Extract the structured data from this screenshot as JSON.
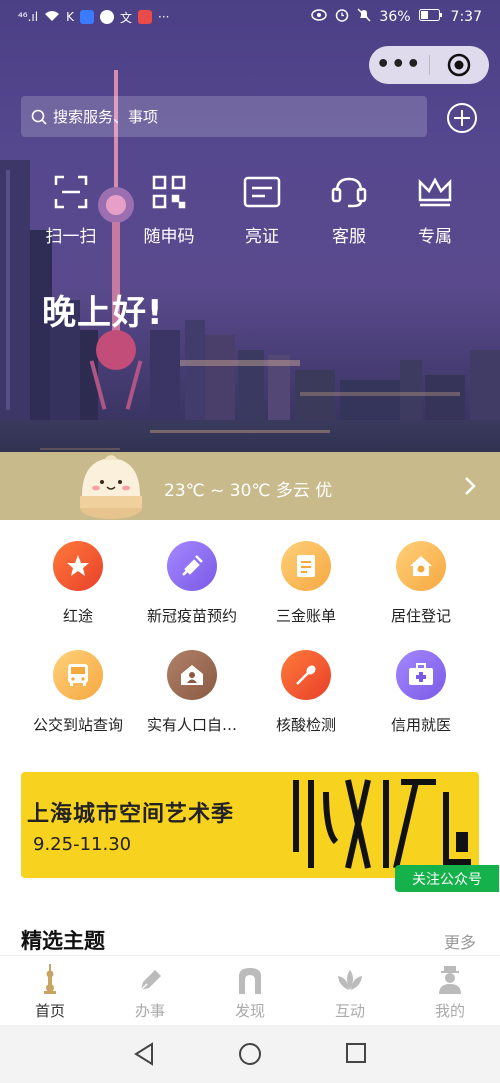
{
  "status": {
    "left": "⁴⁶.ıl",
    "battery": "36%",
    "time": "7:37"
  },
  "capsule": {
    "menu_icon": "more-dots-icon",
    "close_icon": "target-icon"
  },
  "search": {
    "placeholder": "搜索服务、事项"
  },
  "quick_actions": [
    {
      "label": "扫一扫",
      "icon": "scan-icon"
    },
    {
      "label": "随申码",
      "icon": "qr-code-icon"
    },
    {
      "label": "亮证",
      "icon": "id-card-icon"
    },
    {
      "label": "客服",
      "icon": "headset-icon"
    },
    {
      "label": "专属",
      "icon": "crown-icon"
    }
  ],
  "greeting": "晚上好!",
  "weather": {
    "text": "23℃ ~ 30℃ 多云 优"
  },
  "services": [
    {
      "label": "红途",
      "icon": "star-icon",
      "color": "#f0542a"
    },
    {
      "label": "新冠疫苗预约",
      "icon": "syringe-icon",
      "color": "#8a6cf0"
    },
    {
      "label": "三金账单",
      "icon": "bill-icon",
      "color": "#f7b04a"
    },
    {
      "label": "居住登记",
      "icon": "home-icon",
      "color": "#f7b04a"
    },
    {
      "label": "公交到站查询",
      "icon": "bus-icon",
      "color": "#f7b04a"
    },
    {
      "label": "实有人口自…",
      "icon": "person-house-icon",
      "color": "#9b6b52"
    },
    {
      "label": "核酸检测",
      "icon": "swab-icon",
      "color": "#f0542a"
    },
    {
      "label": "信用就医",
      "icon": "medical-kit-icon",
      "color": "#8a6cf0"
    }
  ],
  "banner": {
    "title": "上海城市空间艺术季",
    "date": "9.25-11.30",
    "follow": "关注公众号"
  },
  "section": {
    "title": "精选主题",
    "more": "更多"
  },
  "tabs": [
    {
      "label": "首页",
      "icon": "tower-icon",
      "active": true
    },
    {
      "label": "办事",
      "icon": "pen-icon",
      "active": false
    },
    {
      "label": "发现",
      "icon": "arch-icon",
      "active": false
    },
    {
      "label": "互动",
      "icon": "lotus-icon",
      "active": false
    },
    {
      "label": "我的",
      "icon": "user-icon",
      "active": false
    }
  ]
}
